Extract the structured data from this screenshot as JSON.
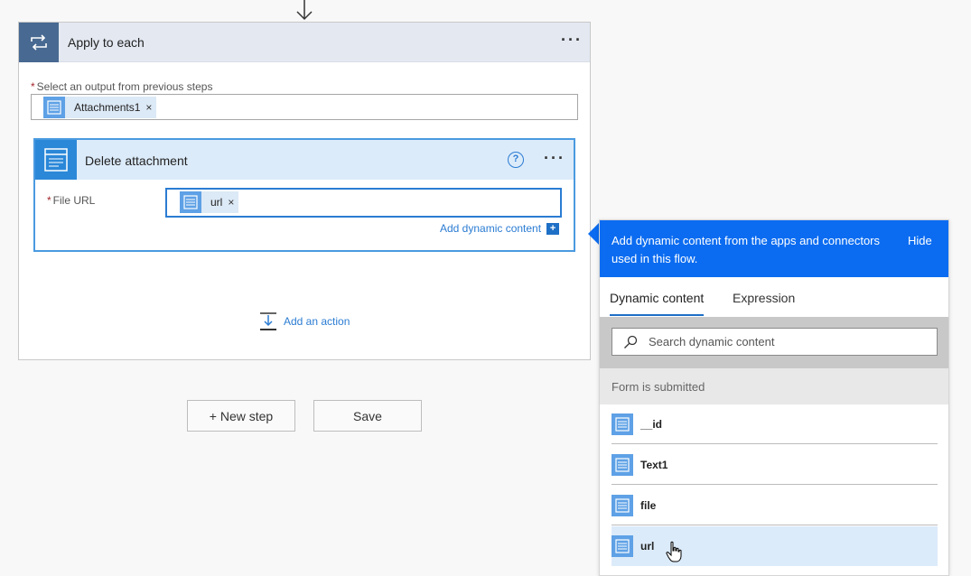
{
  "apply_each": {
    "title": "Apply to each",
    "select_label": "Select an output from previous steps",
    "select_required": "*",
    "token": "Attachments1",
    "token_remove": "×"
  },
  "delete_attachment": {
    "title": "Delete attachment",
    "help": "?",
    "file_url_label": "File URL",
    "file_url_required": "*",
    "url_token": "url",
    "url_token_remove": "×",
    "add_dynamic": "Add dynamic content",
    "add_dynamic_plus": "+"
  },
  "more_menu": "···",
  "add_action": "Add an action",
  "buttons": {
    "new_step": "+ New step",
    "save": "Save"
  },
  "dynamic_panel": {
    "description": "Add dynamic content from the apps and connectors used in this flow.",
    "hide": "Hide",
    "tabs": [
      "Dynamic content",
      "Expression"
    ],
    "search_placeholder": "Search dynamic content",
    "section": "Form is submitted",
    "items": [
      "__id",
      "Text1",
      "file",
      "url"
    ],
    "hovered_item": "url"
  },
  "colors": {
    "accent": "#0b6cf1",
    "apply_header": "#486991",
    "delete_header": "#2b88d8",
    "token_icon": "#5ea1e6"
  }
}
